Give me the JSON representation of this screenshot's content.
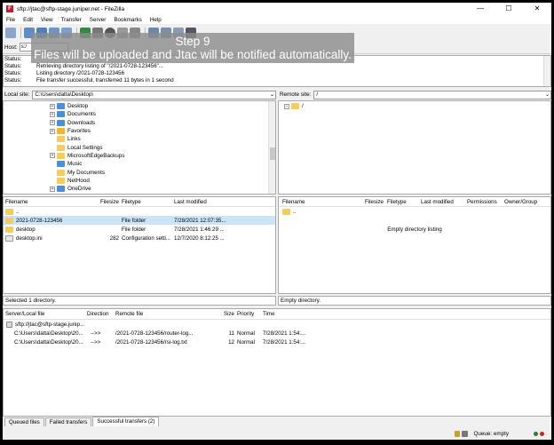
{
  "window": {
    "title": "sftp://jtac@sftp-stage.juniper.net - FileZilla",
    "controls": [
      "—",
      "☐",
      "✕"
    ]
  },
  "menu": [
    "File",
    "Edit",
    "View",
    "Transfer",
    "Server",
    "Bookmarks",
    "Help"
  ],
  "overlay": {
    "line1": "Step 9",
    "line2": "Files will be uploaded and Jtac will be notified automatically."
  },
  "quickconnect": {
    "host_label": "Host:",
    "host_value": "s:/"
  },
  "message_log": [
    {
      "type": "Status:",
      "text": ""
    },
    {
      "type": "Status:",
      "text": "Retrieving directory listing of \"/2021-0728-123456\"..."
    },
    {
      "type": "Status:",
      "text": "Listing directory /2021-0728-123456"
    },
    {
      "type": "Status:",
      "text": "File transfer successful, transferred 11 bytes in 1 second"
    }
  ],
  "local_site": {
    "label": "Local site:",
    "path": "C:\\Users\\datta\\Desktop\\"
  },
  "remote_site": {
    "label": "Remote site:",
    "path": "/"
  },
  "local_tree": [
    {
      "label": "Desktop",
      "icon": "blue-folder",
      "expander": "+"
    },
    {
      "label": "Documents",
      "icon": "blue-folder",
      "expander": "+"
    },
    {
      "label": "Downloads",
      "icon": "blue-folder",
      "expander": "+"
    },
    {
      "label": "Favorites",
      "icon": "star-folder",
      "expander": "+"
    },
    {
      "label": "Links",
      "icon": "folder",
      "expander": ""
    },
    {
      "label": "Local Settings",
      "icon": "folder",
      "expander": ""
    },
    {
      "label": "MicrosoftEdgeBackups",
      "icon": "folder",
      "expander": "+"
    },
    {
      "label": "Music",
      "icon": "blue-folder",
      "expander": ""
    },
    {
      "label": "My Documents",
      "icon": "folder",
      "expander": ""
    },
    {
      "label": "NetHood",
      "icon": "folder",
      "expander": ""
    },
    {
      "label": "OneDrive",
      "icon": "blue-folder",
      "expander": "+"
    }
  ],
  "remote_tree": [
    {
      "label": "/",
      "expander": "−"
    }
  ],
  "local_files": {
    "headers": [
      "Filename",
      "Filesize",
      "Filetype",
      "Last modified"
    ],
    "rows": [
      {
        "name": "..",
        "size": "",
        "type": "",
        "modified": "",
        "icon": "folder"
      },
      {
        "name": "2021-0728-123456",
        "size": "",
        "type": "File folder",
        "modified": "7/28/2021 12:07:35...",
        "icon": "folder",
        "selected": true
      },
      {
        "name": "desktop",
        "size": "",
        "type": "File folder",
        "modified": "7/28/2021 1:46:29 ...",
        "icon": "folder"
      },
      {
        "name": "desktop.ini",
        "size": "282",
        "type": "Configuration setti...",
        "modified": "12/7/2020 8:12:25 ...",
        "icon": "file"
      }
    ],
    "status": "Selected 1 directory."
  },
  "remote_files": {
    "headers": [
      "Filename",
      "Filesize",
      "Filetype",
      "Last modified",
      "Permissions",
      "Owner/Group"
    ],
    "rows": [
      {
        "name": "..",
        "icon": "folder"
      }
    ],
    "empty_text": "Empty directory listing",
    "status": "Empty directory."
  },
  "queue": {
    "headers": [
      "Server/Local file",
      "Direction",
      "Remote file",
      "Size",
      "Priority",
      "Time"
    ],
    "server": "sftp://jtac@sftp-stage.junip...",
    "rows": [
      {
        "local": "C:\\Users\\datta\\Desktop\\20...",
        "direction": "-->>",
        "remote": "/2021-0728-123456/router-log...",
        "size": "11",
        "priority": "Normal",
        "time": "7/28/2021 1:54:..."
      },
      {
        "local": "C:\\Users\\datta\\Desktop\\20...",
        "direction": "-->>",
        "remote": "/2021-0728-123456/rsi-log.txt",
        "size": "12",
        "priority": "Normal",
        "time": "7/28/2021 1:54:..."
      }
    ]
  },
  "tabs": [
    "Queued files",
    "Failed transfers",
    "Successful transfers (2)"
  ],
  "statusbar": {
    "queue": "Queue: empty"
  },
  "colors": {
    "accent": "#bf1e2e",
    "selection": "#cce4f7",
    "folder": "#f6cd5a"
  }
}
